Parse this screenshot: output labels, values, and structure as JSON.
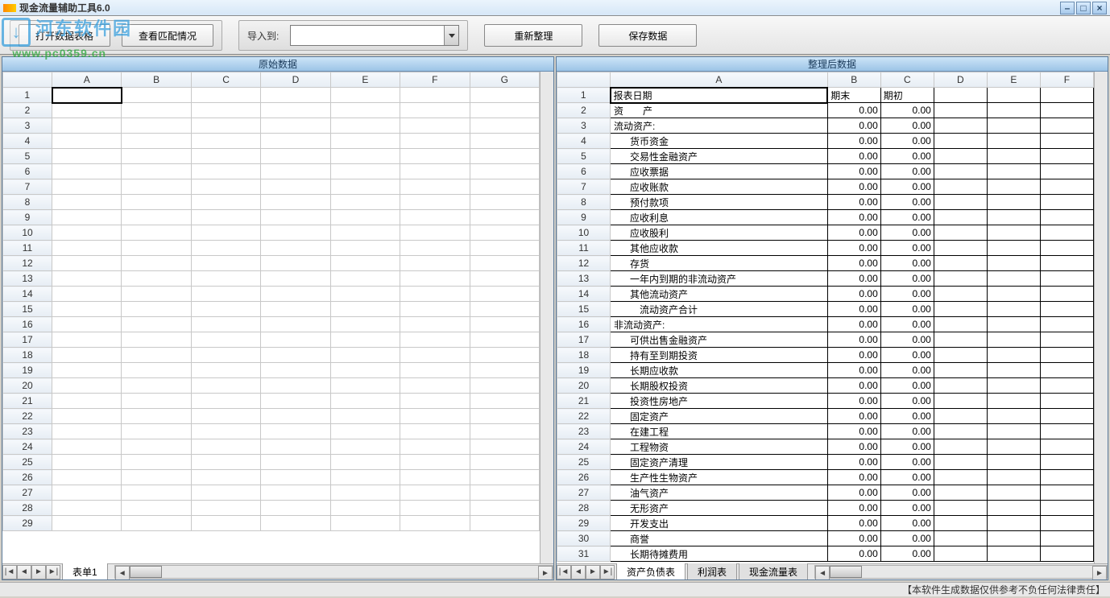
{
  "window": {
    "title": "现金流量辅助工具6.0"
  },
  "toolbar": {
    "open_data": "打开数据表格",
    "view_match": "查看匹配情况",
    "import_to": "导入到:",
    "reorganize": "重新整理",
    "save_data": "保存数据"
  },
  "watermark": {
    "site_cn": "河东软件园",
    "site_url": "www.pc0359.cn"
  },
  "left_pane": {
    "title": "原始数据",
    "columns": [
      "A",
      "B",
      "C",
      "D",
      "E",
      "F",
      "G"
    ],
    "row_count": 29,
    "tabs": [
      "表单1"
    ]
  },
  "right_pane": {
    "title": "整理后数据",
    "columns": [
      "A",
      "B",
      "C",
      "D",
      "E",
      "F"
    ],
    "header_row": {
      "a": "报表日期",
      "b": "期末",
      "c": "期初"
    },
    "rows": [
      {
        "n": 2,
        "a": "资　　产",
        "b": "0.00",
        "c": "0.00",
        "indent": 1
      },
      {
        "n": 3,
        "a": "流动资产:",
        "b": "0.00",
        "c": "0.00",
        "indent": 1
      },
      {
        "n": 4,
        "a": "货币资金",
        "b": "0.00",
        "c": "0.00",
        "indent": 2
      },
      {
        "n": 5,
        "a": "交易性金融资产",
        "b": "0.00",
        "c": "0.00",
        "indent": 2
      },
      {
        "n": 6,
        "a": "应收票据",
        "b": "0.00",
        "c": "0.00",
        "indent": 2
      },
      {
        "n": 7,
        "a": "应收账款",
        "b": "0.00",
        "c": "0.00",
        "indent": 2
      },
      {
        "n": 8,
        "a": "预付款项",
        "b": "0.00",
        "c": "0.00",
        "indent": 2
      },
      {
        "n": 9,
        "a": "应收利息",
        "b": "0.00",
        "c": "0.00",
        "indent": 2
      },
      {
        "n": 10,
        "a": "应收股利",
        "b": "0.00",
        "c": "0.00",
        "indent": 2
      },
      {
        "n": 11,
        "a": "其他应收款",
        "b": "0.00",
        "c": "0.00",
        "indent": 2
      },
      {
        "n": 12,
        "a": "存货",
        "b": "0.00",
        "c": "0.00",
        "indent": 2
      },
      {
        "n": 13,
        "a": "一年内到期的非流动资产",
        "b": "0.00",
        "c": "0.00",
        "indent": 2
      },
      {
        "n": 14,
        "a": "其他流动资产",
        "b": "0.00",
        "c": "0.00",
        "indent": 2
      },
      {
        "n": 15,
        "a": "流动资产合计",
        "b": "0.00",
        "c": "0.00",
        "indent": 3
      },
      {
        "n": 16,
        "a": "非流动资产:",
        "b": "0.00",
        "c": "0.00",
        "indent": 1
      },
      {
        "n": 17,
        "a": "可供出售金融资产",
        "b": "0.00",
        "c": "0.00",
        "indent": 2
      },
      {
        "n": 18,
        "a": "持有至到期投资",
        "b": "0.00",
        "c": "0.00",
        "indent": 2
      },
      {
        "n": 19,
        "a": "长期应收款",
        "b": "0.00",
        "c": "0.00",
        "indent": 2
      },
      {
        "n": 20,
        "a": "长期股权投资",
        "b": "0.00",
        "c": "0.00",
        "indent": 2
      },
      {
        "n": 21,
        "a": "投资性房地产",
        "b": "0.00",
        "c": "0.00",
        "indent": 2
      },
      {
        "n": 22,
        "a": "固定资产",
        "b": "0.00",
        "c": "0.00",
        "indent": 2
      },
      {
        "n": 23,
        "a": "在建工程",
        "b": "0.00",
        "c": "0.00",
        "indent": 2
      },
      {
        "n": 24,
        "a": "工程物资",
        "b": "0.00",
        "c": "0.00",
        "indent": 2
      },
      {
        "n": 25,
        "a": "固定资产清理",
        "b": "0.00",
        "c": "0.00",
        "indent": 2
      },
      {
        "n": 26,
        "a": "生产性生物资产",
        "b": "0.00",
        "c": "0.00",
        "indent": 2
      },
      {
        "n": 27,
        "a": "油气资产",
        "b": "0.00",
        "c": "0.00",
        "indent": 2
      },
      {
        "n": 28,
        "a": "无形资产",
        "b": "0.00",
        "c": "0.00",
        "indent": 2
      },
      {
        "n": 29,
        "a": "开发支出",
        "b": "0.00",
        "c": "0.00",
        "indent": 2
      },
      {
        "n": 30,
        "a": "商誉",
        "b": "0.00",
        "c": "0.00",
        "indent": 2
      },
      {
        "n": 31,
        "a": "长期待摊费用",
        "b": "0.00",
        "c": "0.00",
        "indent": 2
      }
    ],
    "tabs": [
      "资产负债表",
      "利润表",
      "现金流量表"
    ]
  },
  "statusbar": {
    "text": "【本软件生成数据仅供参考不负任何法律责任】"
  }
}
